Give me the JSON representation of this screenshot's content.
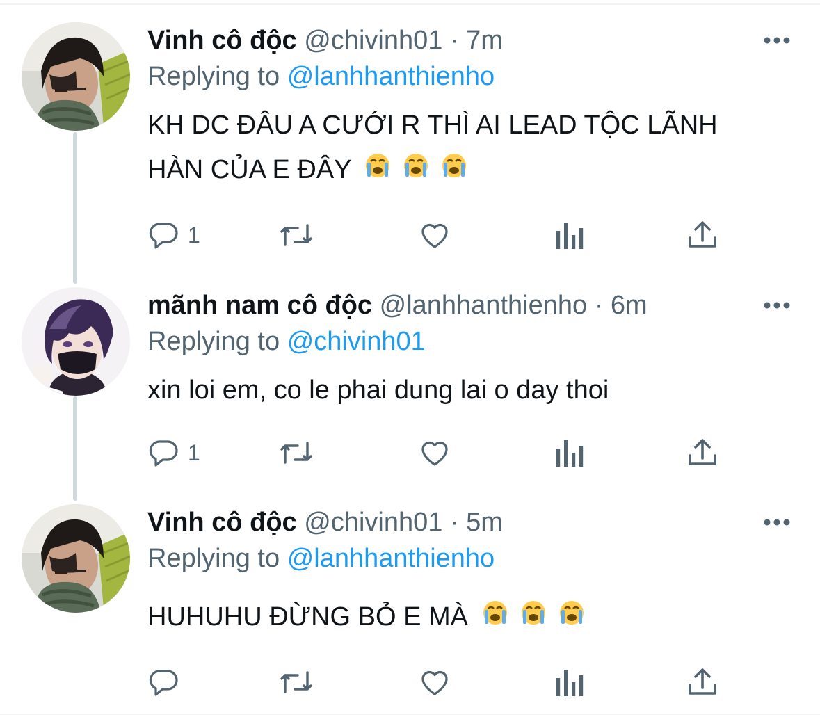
{
  "tweets": [
    {
      "name": "Vinh cô độc",
      "handle": "@chivinh01",
      "dot": "·",
      "time": "7m",
      "replying_prefix": "Replying to",
      "replying_to": "@lanhhanthienho",
      "text_lines": [
        "KH DC ĐÂU A CƯỚI R THÌ AI LEAD TỘC LÃNH",
        "HÀN CỦA E ĐÂY"
      ],
      "emoji": "loudly-crying-face x3",
      "reply_count": "1"
    },
    {
      "name": "mãnh nam cô độc",
      "handle": "@lanhhanthienho",
      "dot": "·",
      "time": "6m",
      "replying_prefix": "Replying to",
      "replying_to": "@chivinh01",
      "text_lines": [
        "xin loi em, co le phai dung lai o day thoi"
      ],
      "reply_count": "1"
    },
    {
      "name": "Vinh cô độc",
      "handle": "@chivinh01",
      "dot": "·",
      "time": "5m",
      "replying_prefix": "Replying to",
      "replying_to": "@lanhhanthienho",
      "text_lines": [
        "HUHUHU ĐỪNG BỎ E MÀ"
      ],
      "emoji": "loudly-crying-face x3",
      "reply_count": ""
    }
  ],
  "icons": {
    "reply": "reply-icon",
    "retweet": "retweet-icon",
    "like": "heart-icon",
    "analytics": "analytics-icon",
    "share": "share-icon",
    "more": "more-icon"
  },
  "colors": {
    "text": "#0f1419",
    "secondary": "#536471",
    "link": "#1d9bf0",
    "thread_line": "#cfd9de"
  }
}
